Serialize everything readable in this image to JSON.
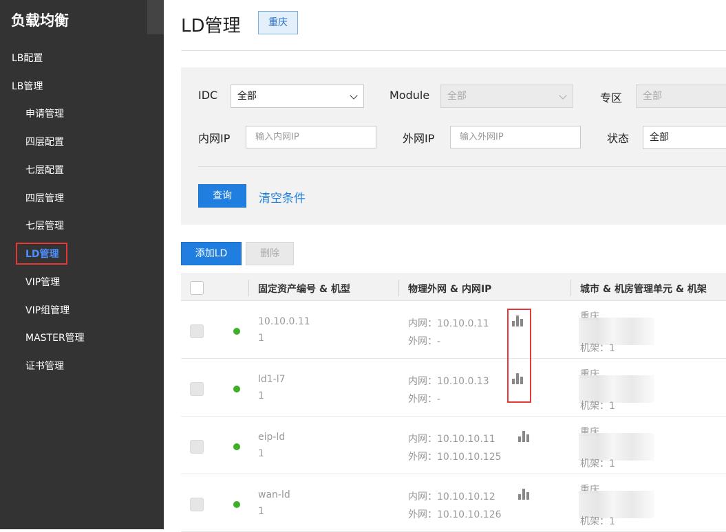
{
  "sidebar": {
    "brand": "负载均衡",
    "items": [
      {
        "label": "LB配置",
        "level": "top"
      },
      {
        "label": "LB管理",
        "level": "top"
      },
      {
        "label": "申请管理",
        "level": "sub"
      },
      {
        "label": "四层配置",
        "level": "sub"
      },
      {
        "label": "七层配置",
        "level": "sub"
      },
      {
        "label": "四层管理",
        "level": "sub"
      },
      {
        "label": "七层管理",
        "level": "sub"
      },
      {
        "label": "LD管理",
        "level": "sub",
        "active": true
      },
      {
        "label": "VIP管理",
        "level": "sub"
      },
      {
        "label": "VIP组管理",
        "level": "sub"
      },
      {
        "label": "MASTER管理",
        "level": "sub"
      },
      {
        "label": "证书管理",
        "level": "sub"
      }
    ]
  },
  "header": {
    "title": "LD管理",
    "city_tag": "重庆"
  },
  "filters": {
    "idc_label": "IDC",
    "idc_value": "全部",
    "module_label": "Module",
    "module_value": "全部",
    "zone_label": "专区",
    "zone_value": "全部",
    "inner_ip_label": "内网IP",
    "inner_ip_placeholder": "输入内网IP",
    "outer_ip_label": "外网IP",
    "outer_ip_placeholder": "输入外网IP",
    "status_label": "状态",
    "status_value": "全部",
    "query_label": "查询",
    "clear_label": "清空条件"
  },
  "actions": {
    "add_label": "添加LD",
    "delete_label": "删除"
  },
  "table": {
    "columns": [
      "固定资产编号 & 机型",
      "物理外网 & 内网IP",
      "城市 & 机房管理单元 & 机架"
    ],
    "rows": [
      {
        "asset": "10.10.0.11",
        "model": "1",
        "inner_ip": "内网：10.10.0.11",
        "outer_ip": "外网：-",
        "city": "重庆",
        "rack": "机架：1",
        "status_color": "#3fae29"
      },
      {
        "asset": "ld1-l7",
        "model": "1",
        "inner_ip": "内网：10.10.0.13",
        "outer_ip": "外网：-",
        "city": "重庆",
        "rack": "机架：1",
        "status_color": "#3fae29"
      },
      {
        "asset": "eip-ld",
        "model": "1",
        "inner_ip": "内网：10.10.10.11",
        "outer_ip": "外网：10.10.10.125",
        "city": "重庆",
        "rack": "机架：1",
        "status_color": "#3fae29"
      },
      {
        "asset": "wan-ld",
        "model": "1",
        "inner_ip": "内网：10.10.10.12",
        "outer_ip": "外网：10.10.10.126",
        "city": "重庆",
        "rack": "机架：1",
        "status_color": "#3fae29"
      }
    ]
  },
  "colors": {
    "sidebar_bg": "#333333",
    "accent": "#1f7ee0",
    "highlight_border": "#e53935",
    "status_online": "#3fae29"
  }
}
